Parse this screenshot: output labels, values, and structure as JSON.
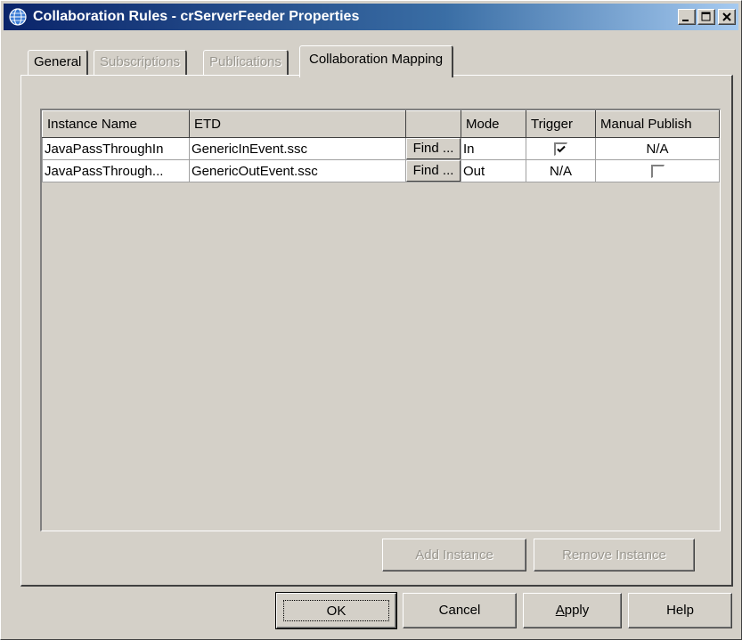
{
  "window": {
    "title": "Collaboration Rules - crServerFeeder Properties"
  },
  "tabs": [
    {
      "label": "General",
      "state": "enabled"
    },
    {
      "label": "Subscriptions",
      "state": "disabled"
    },
    {
      "label": "Publications",
      "state": "disabled"
    },
    {
      "label": "Collaboration Mapping",
      "state": "active"
    }
  ],
  "table": {
    "columns": [
      "Instance Name",
      "ETD",
      "",
      "Mode",
      "Trigger",
      "Manual Publish"
    ],
    "rows": [
      {
        "instance_name": "JavaPassThroughIn",
        "etd": "GenericInEvent.ssc",
        "find_label": "Find ...",
        "mode": "In",
        "trigger": "checked",
        "manual_publish": "N/A"
      },
      {
        "instance_name": "JavaPassThrough...",
        "etd": "GenericOutEvent.ssc",
        "find_label": "Find ...",
        "mode": "Out",
        "trigger": "N/A",
        "manual_publish": "unchecked"
      }
    ]
  },
  "panel_buttons": {
    "add_instance": "Add Instance",
    "remove_instance": "Remove Instance"
  },
  "dialog_buttons": {
    "ok": "OK",
    "cancel": "Cancel",
    "apply": "Apply",
    "help": "Help"
  },
  "colors": {
    "title_bar_start": "#0a246a",
    "title_bar_end": "#a6caf0",
    "face": "#d4d0c8"
  }
}
